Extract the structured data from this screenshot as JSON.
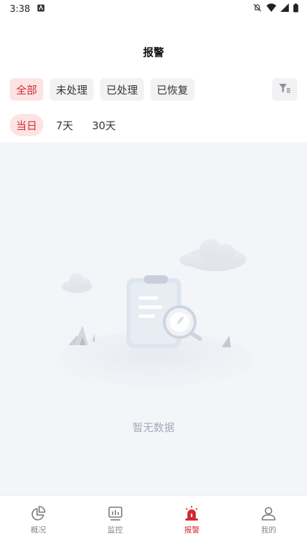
{
  "status": {
    "time": "3:38"
  },
  "header": {
    "title": "报警"
  },
  "filters": {
    "status_chips": [
      {
        "label": "全部",
        "active": true
      },
      {
        "label": "未处理",
        "active": false
      },
      {
        "label": "已处理",
        "active": false
      },
      {
        "label": "已恢复",
        "active": false
      }
    ],
    "filter_icon": "filter-icon",
    "time_chips": [
      {
        "label": "当日",
        "active": true
      },
      {
        "label": "7天",
        "active": false
      },
      {
        "label": "30天",
        "active": false
      }
    ]
  },
  "empty": {
    "text": "暂无数据"
  },
  "nav": {
    "items": [
      {
        "label": "概况",
        "icon": "pie-chart-icon",
        "active": false
      },
      {
        "label": "监控",
        "icon": "monitor-icon",
        "active": false
      },
      {
        "label": "报警",
        "icon": "alarm-icon",
        "active": true
      },
      {
        "label": "我的",
        "icon": "user-icon",
        "active": false
      }
    ]
  },
  "colors": {
    "accent": "#d42a2f",
    "chip_active_bg": "#fde3e4",
    "content_bg": "#f3f5f9"
  }
}
